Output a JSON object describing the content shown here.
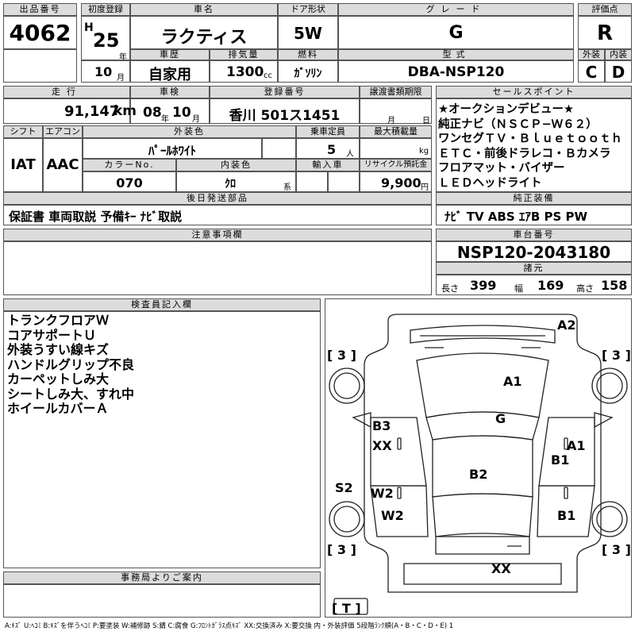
{
  "headers": {
    "lot": "出品番号",
    "first_reg": "初度登録",
    "car_name": "車名",
    "door": "ドア形状",
    "grade": "グレード",
    "score": "評価点",
    "history": "車歴",
    "displacement": "排気量",
    "fuel": "燃料",
    "model": "型式",
    "exterior": "外装",
    "interior": "内装",
    "mileage": "走行",
    "inspection": "車検",
    "reg_no": "登録番号",
    "transfer": "譲渡書類期限",
    "sales_points": "セールスポイント",
    "shift": "シフト",
    "aircon": "エアコン",
    "ext_color": "外装色",
    "capacity": "乗車定員",
    "max_load": "最大積載量",
    "color_no": "カラーNo.",
    "int_color": "内装色",
    "import": "輸入車",
    "recycle": "リサイクル預託金",
    "later_parts": "後日発送部品",
    "genuine": "純正装備",
    "notes": "注意事項欄",
    "chassis": "車台番号",
    "specs": "諸元",
    "inspector": "検査員記入欄",
    "office": "事務局よりご案内"
  },
  "lot_no": "4062",
  "era": "H",
  "year": "25",
  "year_unit": "年",
  "month": "10",
  "month_unit": "月",
  "car_name": "ラクティス",
  "door": "5W",
  "grade": "G",
  "score": "R",
  "history": "自家用",
  "displacement": "1300",
  "displacement_unit": "cc",
  "fuel": "ｶﾞｿﾘﾝ",
  "model": "DBA-NSP120",
  "exterior_score": "C",
  "interior_score": "D",
  "mileage": "91,147",
  "mileage_unit": "km",
  "inspection_year": "08",
  "inspection_year_unit": "年",
  "inspection_month": "10",
  "inspection_month_unit": "月",
  "reg_no": "香川 501ス1451",
  "transfer_month": "月",
  "transfer_day": "日",
  "sales_points": [
    "★オークションデビュー★",
    "純正ナビ（ＮＳＣＰ−Ｗ６２）",
    "ワンセグＴＶ・Ｂｌｕｅｔｏｏｔｈ",
    "ＥＴＣ・前後ドラレコ・Ｂカメラ",
    "フロアマット・バイザー",
    "ＬＥＤヘッドライト"
  ],
  "shift": "IAT",
  "aircon": "AAC",
  "ext_color": "ﾊﾟｰﾙﾎﾜｲﾄ",
  "capacity": "5",
  "capacity_unit": "人",
  "max_load_unit": "kg",
  "color_no": "070",
  "int_color": "ｸﾛ",
  "int_color_unit": "系",
  "recycle": "9,900",
  "recycle_unit": "円",
  "later_parts": "保証書 車両取説 予備ｷｰ ﾅﾋﾞ取説",
  "genuine": "ﾅﾋﾞ TV ABS ｴｱB PS PW",
  "chassis_no": "NSP120-2043180",
  "length_label": "長さ",
  "length": "399",
  "width_label": "幅",
  "width": "169",
  "height_label": "高さ",
  "height": "158",
  "inspector_notes": [
    "トランクフロアＷ",
    "コアサポートＵ",
    "外装うすい線キズ",
    "ハンドルグリップ不良",
    "カーペットしみ大",
    "シートしみ大、すれ中",
    "ホイールカバーＡ"
  ],
  "diagram": {
    "tire_fl": "[ 3 ]",
    "tire_fr": "[ 3 ]",
    "tire_rl": "[ 3 ]",
    "tire_rr": "[ 3 ]",
    "spare": "[ T ]",
    "a2": "A2",
    "a1_top": "A1",
    "g": "G",
    "b3": "B3",
    "xx_left": "XX",
    "a1_right": "A1",
    "b1_right": "B1",
    "b2": "B2",
    "s2": "S2",
    "w2_a": "W2",
    "w2_b": "W2",
    "b1_rear": "B1",
    "xx_rear": "XX"
  },
  "legend": "A:ｷｽﾞ U:ﾍｺﾐ B:ｷｽﾞを伴うﾍｺﾐ P:要塗装 W:補修跡 S:錆 C:腐食 G:ﾌﾛﾝﾄｶﾞﾗｽ点ｷｽﾞ XX:交換済み X:要交換 内・外装評価 5段階ﾗﾝｸ順(A・B・C・D・E) 1"
}
